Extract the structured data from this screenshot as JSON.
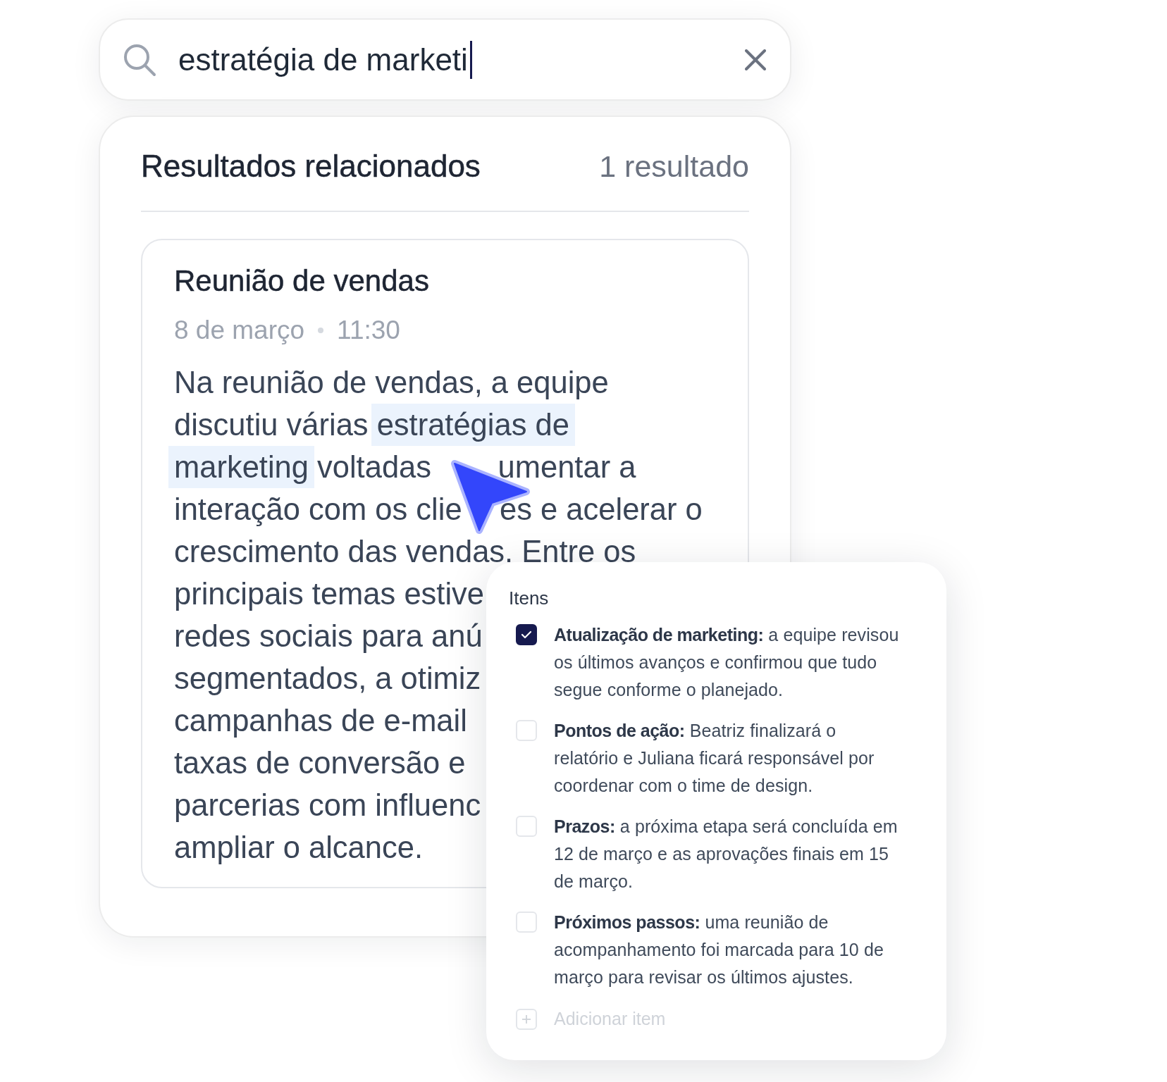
{
  "search": {
    "value": "estratégia de marketi",
    "focused": true
  },
  "results": {
    "title": "Resultados relacionados",
    "count": "1 resultado",
    "items": [
      {
        "title": "Reunião de vendas",
        "date": "8 de março",
        "time": "11:30",
        "body_lines": [
          [
            {
              "text": "Na reunião de vendas, a equipe",
              "highlighted": false
            }
          ],
          [
            {
              "text": "discutiu várias",
              "highlighted": false
            },
            {
              "text": "estratégias de",
              "highlighted": true
            }
          ],
          [
            {
              "text": "marketing",
              "highlighted": true
            },
            {
              "text": "voltadas",
              "highlighted": false
            },
            {
              "text": "umentar a",
              "highlighted": false
            }
          ],
          [
            {
              "text": "interação com os clie",
              "highlighted": false
            },
            {
              "text": "es e acelerar o",
              "highlighted": false
            }
          ],
          [
            {
              "text": "crescimento das vendas. Entre os",
              "highlighted": false
            }
          ],
          [
            {
              "text": "principais temas estive",
              "highlighted": false
            }
          ],
          [
            {
              "text": "redes sociais para anú",
              "highlighted": false
            }
          ],
          [
            {
              "text": "segmentados, a otimiz",
              "highlighted": false
            }
          ],
          [
            {
              "text": "campanhas de e-mail",
              "highlighted": false
            }
          ],
          [
            {
              "text": "taxas de conversão e",
              "highlighted": false
            }
          ],
          [
            {
              "text": "parcerias com influenc",
              "highlighted": false
            }
          ],
          [
            {
              "text": "ampliar o alcance.",
              "highlighted": false
            }
          ]
        ]
      }
    ]
  },
  "items_panel": {
    "title": "Itens",
    "items": [
      {
        "checked": true,
        "text": "**Atualização de marketing:** a equipe revisou os últimos avanços e confirmou que tudo segue conforme o planejado."
      },
      {
        "checked": false,
        "text": "**Pontos de ação:** Beatriz finalizará o relatório e Juliana ficará responsável por coordenar com o time de design."
      },
      {
        "checked": false,
        "text": "**Prazos:** a próxima etapa será concluída em 12 de março e as aprovações finais em 15 de março."
      },
      {
        "checked": false,
        "text": "**Próximos passos:** uma reunião de acompanhamento foi marcada para 10 de março para revisar os últimos ajustes."
      }
    ],
    "add_item": {
      "placeholder": "Adicionar item"
    }
  }
}
